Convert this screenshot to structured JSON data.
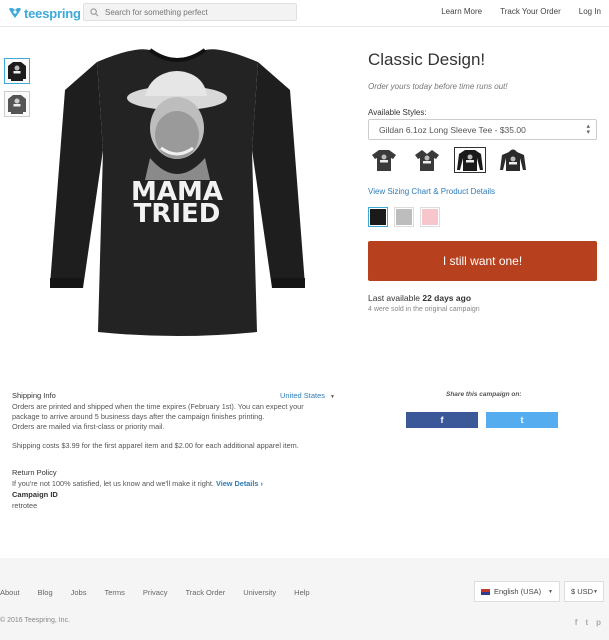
{
  "header": {
    "logo_text": "teespring",
    "search_placeholder": "Search for something perfect",
    "nav": [
      "Learn More",
      "Track Your Order",
      "Log In"
    ]
  },
  "product": {
    "title": "Classic Design!",
    "subtitle": "Order yours today before time runs out!",
    "styles_label": "Available Styles:",
    "selected_style": "Gildan 6.1oz Long Sleeve Tee - $35.00",
    "style_count": 4,
    "selected_style_index": 2,
    "sizing_link": "View Sizing Chart & Product Details",
    "colors": [
      "#1a1a1a",
      "#bdbdbd",
      "#f7c5cc"
    ],
    "selected_color_index": 0,
    "cta_label": "I still want one!",
    "cta_color": "#b7401e",
    "last_available_prefix": "Last available ",
    "last_available_value": "22 days ago",
    "sold_count": "4 were sold in the original campaign",
    "shirt_text_line1": "MAMA",
    "shirt_text_line2": "TRIED"
  },
  "shipping": {
    "title": "Shipping Info",
    "country": "United States",
    "line1": "Orders are printed and shipped when the time expires (February 1st). You can expect your",
    "line2": "package to arrive around 5 business days after the campaign finishes printing.",
    "line3": "Orders are mailed via first-class or priority mail.",
    "costs": "Shipping costs $3.99 for the first apparel item and $2.00 for each additional apparel item."
  },
  "share": {
    "label": "Share this campaign on:",
    "facebook": "f",
    "twitter": "t"
  },
  "return_policy": {
    "title": "Return Policy",
    "text": "If you're not 100% satisfied, let us know and we'll make it right.",
    "link": "View Details ›"
  },
  "campaign": {
    "title": "Campaign ID",
    "id": "retrotee"
  },
  "footer": {
    "links": [
      "About",
      "Blog",
      "Jobs",
      "Terms",
      "Privacy",
      "Track Order",
      "University",
      "Help"
    ],
    "language": "English (USA)",
    "currency": "$ USD",
    "copyright": "© 2016 Teespring, Inc.",
    "social": [
      "f",
      "t",
      "p"
    ]
  }
}
